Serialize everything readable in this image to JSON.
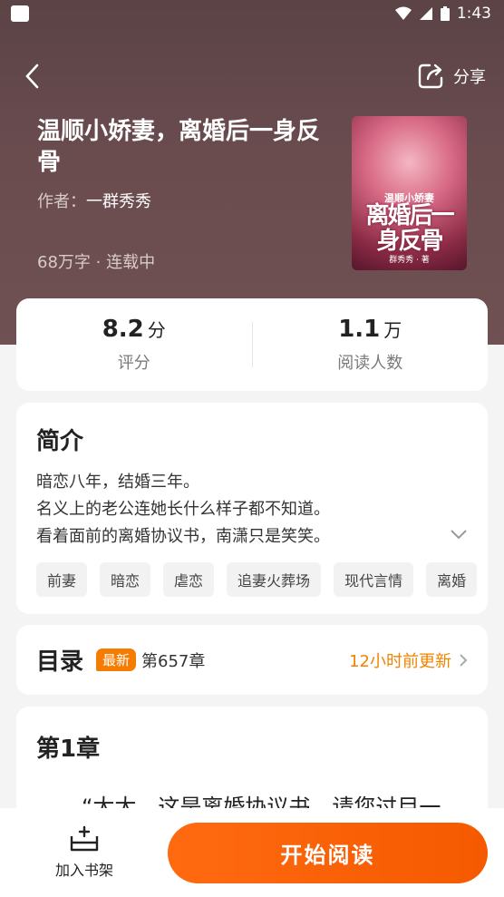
{
  "status_bar": {
    "time": "1:43"
  },
  "nav": {
    "share_label": "分享"
  },
  "book": {
    "title": "温顺小娇妻，离婚后一身反骨",
    "author_prefix": "作者：",
    "author": "一群秀秀",
    "meta": "68万字 · 连载中",
    "cover": {
      "small_title": "温顺小娇妻",
      "big_title": "离婚后一身反骨",
      "author": "群秀秀 · 著"
    }
  },
  "stats": {
    "rating_value": "8.2",
    "rating_unit": "分",
    "rating_label": "评分",
    "readers_value": "1.1",
    "readers_unit": "万",
    "readers_label": "阅读人数"
  },
  "intro": {
    "heading": "简介",
    "lines": [
      "暗恋八年，结婚三年。",
      "名义上的老公连她长什么样子都不知道。",
      "看着面前的离婚协议书，南潇只是笑笑。"
    ],
    "tags": [
      "前妻",
      "暗恋",
      "虐恋",
      "追妻火葬场",
      "现代言情",
      "离婚"
    ]
  },
  "toc": {
    "heading": "目录",
    "badge": "最新",
    "latest_chapter": "第657章",
    "updated": "12小时前更新"
  },
  "chapter": {
    "heading": "第1章",
    "first_line": "“太太，这是离婚协议书，请您过目一"
  },
  "bottom": {
    "shelf_label": "加入书架",
    "read_label": "开始阅读"
  },
  "colors": {
    "accent": "#f57c00",
    "hero": "#6a4c4f"
  }
}
